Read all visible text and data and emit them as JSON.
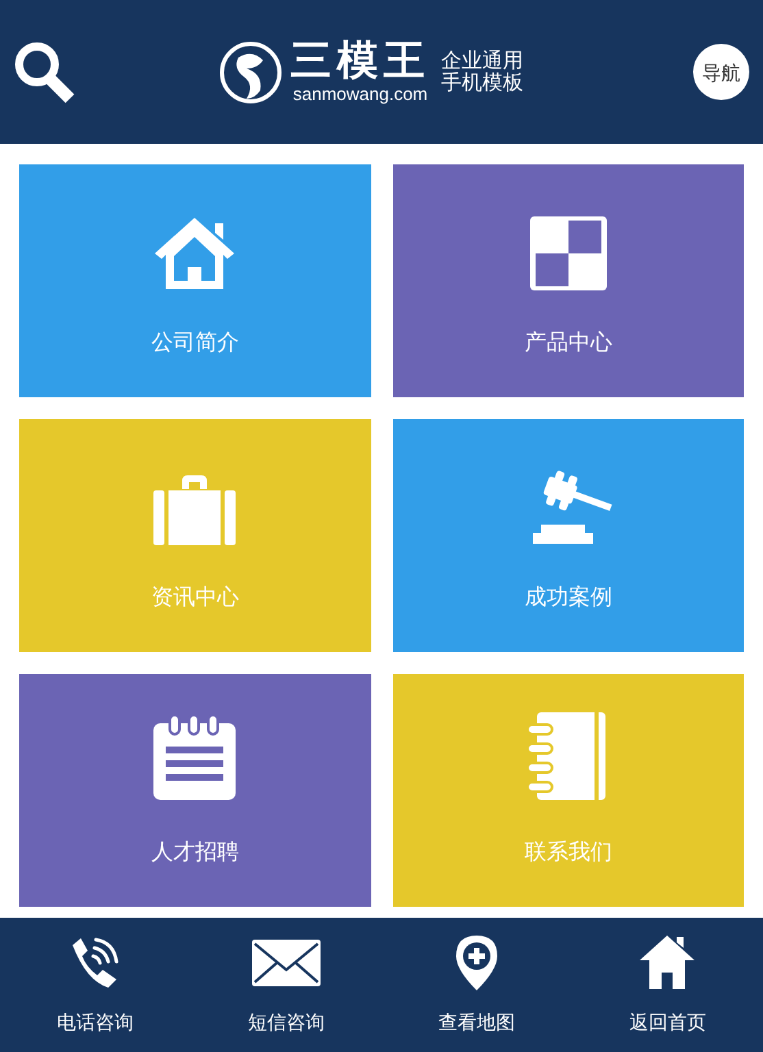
{
  "header": {
    "logo": {
      "name": "三模王",
      "domain": "sanmowang.com",
      "tagline": [
        "企业通用",
        "手机模板"
      ]
    },
    "nav_button": "导航"
  },
  "tiles": [
    {
      "label": "公司简介",
      "color": "#329ee8",
      "kind": "house"
    },
    {
      "label": "产品中心",
      "color": "#6b64b4",
      "kind": "checker"
    },
    {
      "label": "资讯中心",
      "color": "#e5c82b",
      "kind": "briefcase"
    },
    {
      "label": "成功案例",
      "color": "#329ee8",
      "kind": "gavel"
    },
    {
      "label": "人才招聘",
      "color": "#6b64b4",
      "kind": "notepad"
    },
    {
      "label": "联系我们",
      "color": "#e5c82b",
      "kind": "notebook"
    }
  ],
  "footer": [
    {
      "label": "电话咨询",
      "kind": "phone"
    },
    {
      "label": "短信咨询",
      "kind": "mail"
    },
    {
      "label": "查看地图",
      "kind": "pin"
    },
    {
      "label": "返回首页",
      "kind": "home"
    }
  ]
}
